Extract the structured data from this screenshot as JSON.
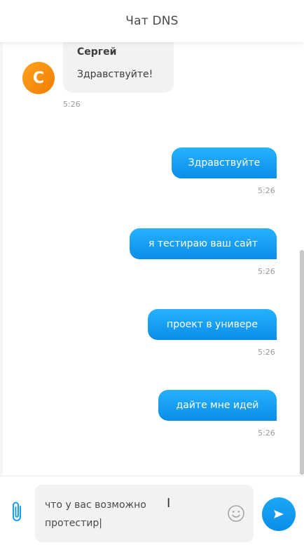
{
  "header": {
    "title": "Чат DNS"
  },
  "incoming": {
    "avatar_letter": "С",
    "author": "Сергей",
    "text": "Здравствуйте!",
    "time": "5:26"
  },
  "outgoing": [
    {
      "text": "Здравствуйте",
      "time": "5:26"
    },
    {
      "text": "я тестираю ваш сайт",
      "time": "5:26"
    },
    {
      "text": "проект в универе",
      "time": "5:26"
    },
    {
      "text": "дайте мне идей",
      "time": "5:26"
    }
  ],
  "composer": {
    "value_line1": "что у вас возможно",
    "value_line2": "протестир|"
  },
  "colors": {
    "accent": "#0a8de8",
    "avatar": "#f38a00",
    "incoming_bubble": "#f2f2f2"
  },
  "icons": {
    "attach": "paperclip-icon",
    "emoji": "smiley-icon",
    "send": "send-arrow-icon"
  }
}
